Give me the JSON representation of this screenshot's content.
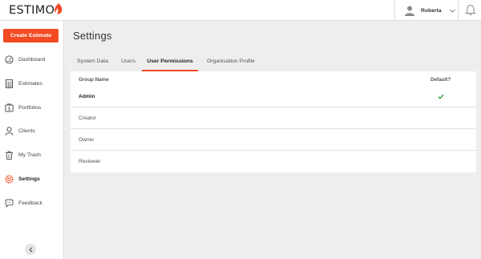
{
  "app": {
    "logo_text": "ESTIMO"
  },
  "header": {
    "user_name": "Roberta"
  },
  "sidebar": {
    "create_button": "Create Estimate",
    "items": [
      {
        "label": "Dashboard",
        "icon": "dashboard-icon"
      },
      {
        "label": "Estimates",
        "icon": "estimates-icon"
      },
      {
        "label": "Portfolios",
        "icon": "portfolios-icon"
      },
      {
        "label": "Clients",
        "icon": "clients-icon"
      },
      {
        "label": "My Trash",
        "icon": "trash-icon"
      },
      {
        "label": "Settings",
        "icon": "settings-icon",
        "active": true
      },
      {
        "label": "Feedback",
        "icon": "feedback-icon"
      }
    ]
  },
  "main": {
    "title": "Settings",
    "tabs": [
      {
        "label": "System Data"
      },
      {
        "label": "Users"
      },
      {
        "label": "User Permissions",
        "active": true
      },
      {
        "label": "Organisation Profile"
      }
    ],
    "table": {
      "columns": [
        "Group Name",
        "Default?"
      ],
      "rows": [
        {
          "name": "Admin",
          "default": true
        },
        {
          "name": "Creator",
          "default": false
        },
        {
          "name": "Owner",
          "default": false
        },
        {
          "name": "Reviewer",
          "default": false
        }
      ]
    }
  },
  "colors": {
    "accent": "#f24a23",
    "check": "#2e9a3e"
  }
}
